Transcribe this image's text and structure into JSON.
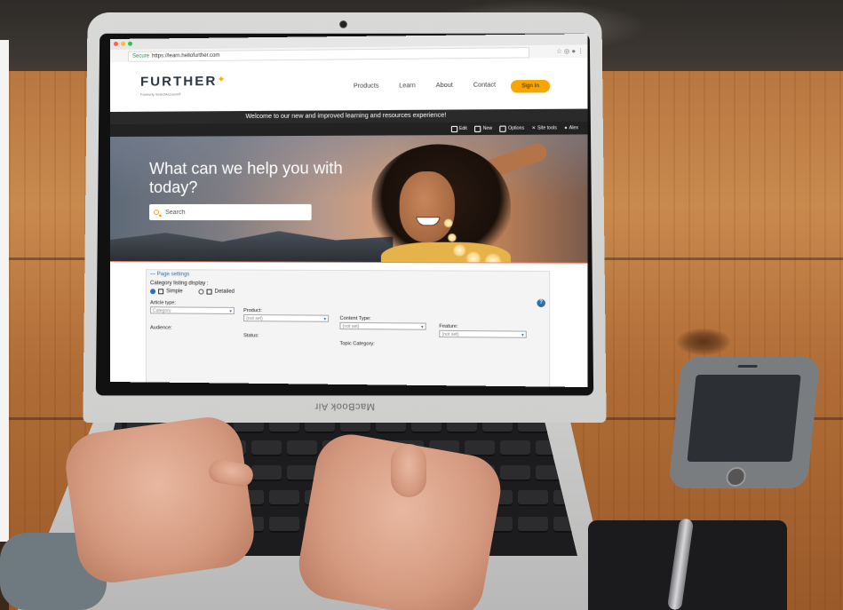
{
  "laptop": {
    "brand": "MacBook Air"
  },
  "browser": {
    "secure_label": "Secure",
    "url": "https://learn.hellofurther.com",
    "ext_icons": "☆ ◎ ● ⋮"
  },
  "site": {
    "logo": "FURTHER",
    "logo_mark": "✦",
    "tagline": "Formerly SelectAccount®",
    "nav": [
      "Products",
      "Learn",
      "About",
      "Contact"
    ],
    "sign_in": "Sign In",
    "welcome": "Welcome to our new and improved learning and resources experience!",
    "toolbar": [
      {
        "icon": "edit-icon",
        "label": "Edit"
      },
      {
        "icon": "new-icon",
        "label": "New"
      },
      {
        "icon": "options-icon",
        "label": "Options"
      },
      {
        "icon": "site-tools-icon",
        "label": "Site tools"
      },
      {
        "icon": "user-icon",
        "label": "Alex"
      }
    ],
    "hero": {
      "title": "What can we help you with today?",
      "search_placeholder": "Search"
    },
    "page_settings": {
      "title": "— Page settings",
      "category_label": "Category listing display :",
      "radio_simple": "Simple",
      "radio_detailed": "Detailed",
      "help": "?",
      "fields": [
        {
          "label": "Article type:",
          "value": "Category"
        },
        {
          "label": "Product:",
          "value": "(not set)"
        },
        {
          "label": "Content Type:",
          "value": "(not set)"
        },
        {
          "label": "Feature:",
          "value": "(not set)"
        },
        {
          "label": "Audience:",
          "value": ""
        },
        {
          "label": "Status:",
          "value": ""
        },
        {
          "label": "Topic Category:",
          "value": ""
        }
      ]
    }
  },
  "colors": {
    "accent": "#f7a600",
    "dark_bar": "#2a2a2a",
    "link_blue": "#2b6fb0"
  }
}
